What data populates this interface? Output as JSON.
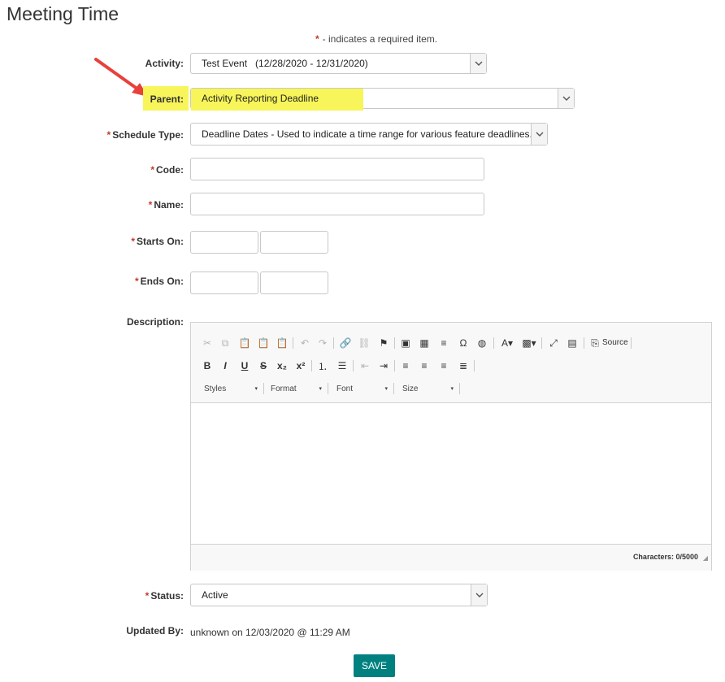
{
  "page": {
    "title": "Meeting Time",
    "required_star": "*",
    "required_note": "- indicates a required item."
  },
  "form": {
    "activity": {
      "label": "Activity:",
      "value": "Test Event   (12/28/2020 - 12/31/2020)"
    },
    "parent": {
      "label": "Parent:",
      "value": "Activity Reporting Deadline"
    },
    "schedule_type": {
      "label": "Schedule Type:",
      "value": "Deadline Dates - Used to indicate a time range for various feature deadlines."
    },
    "code": {
      "label": "Code:",
      "value": ""
    },
    "name": {
      "label": "Name:",
      "value": ""
    },
    "starts_on": {
      "label": "Starts On:",
      "date": "",
      "time": ""
    },
    "ends_on": {
      "label": "Ends On:",
      "date": "",
      "time": ""
    },
    "description": {
      "label": "Description:",
      "value": ""
    },
    "status": {
      "label": "Status:",
      "value": "Active"
    },
    "updated_by": {
      "label": "Updated By:",
      "value": "unknown on 12/03/2020 @ 11:29 AM"
    }
  },
  "editor": {
    "source_label": "Source",
    "combos": [
      "Styles",
      "Format",
      "Font",
      "Size"
    ],
    "char_count": "Characters: 0/5000"
  },
  "buttons": {
    "save": "SAVE"
  },
  "colors": {
    "required": "#c0392b",
    "highlight": "#f7f55a",
    "save_bg": "#00817f",
    "arrow": "#e8413c"
  }
}
